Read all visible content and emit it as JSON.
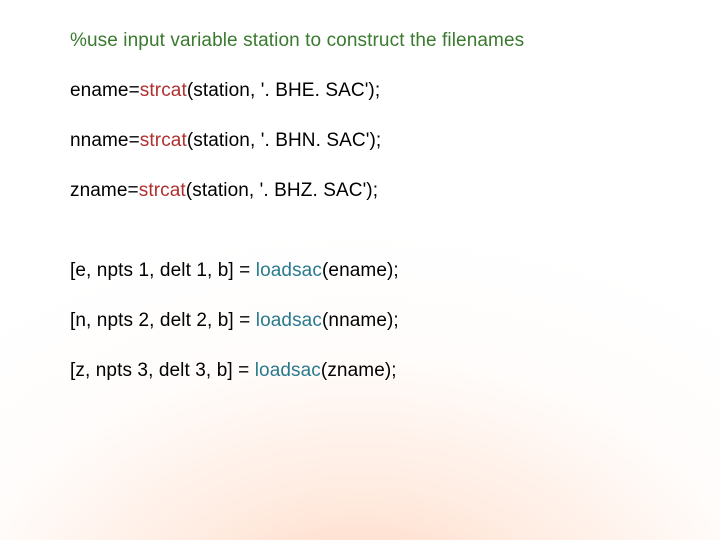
{
  "comment": "%use input variable station to construct the filenames",
  "lines": {
    "strcat": [
      {
        "lhs": "ename=",
        "fn": "strcat",
        "args": "(station, '. BHE. SAC');"
      },
      {
        "lhs": "nname=",
        "fn": "strcat",
        "args": "(station, '. BHN. SAC');"
      },
      {
        "lhs": "zname=",
        "fn": "strcat",
        "args": "(station, '. BHZ. SAC');"
      }
    ],
    "loadsac": [
      {
        "lhs": "[e, npts 1, delt 1, b] = ",
        "fn": "loadsac",
        "args": "(ename);"
      },
      {
        "lhs": "[n, npts 2, delt 2, b] = ",
        "fn": "loadsac",
        "args": "(nname);"
      },
      {
        "lhs": "[z, npts 3, delt 3, b] = ",
        "fn": "loadsac",
        "args": "(zname);"
      }
    ]
  }
}
